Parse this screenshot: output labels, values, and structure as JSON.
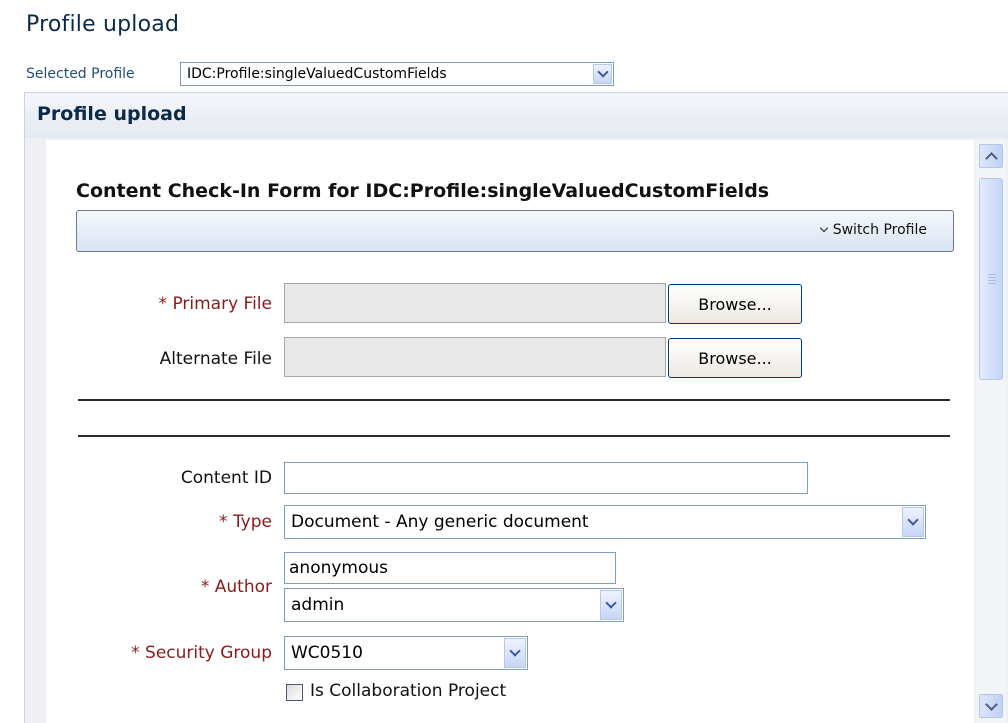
{
  "header": {
    "title": "Profile upload",
    "selected_profile_label": "Selected Profile",
    "selected_profile_value": "IDC:Profile:singleValuedCustomFields"
  },
  "panel": {
    "title": "Profile upload"
  },
  "form": {
    "title": "Content Check-In Form for IDC:Profile:singleValuedCustomFields",
    "switch_profile_label": "Switch Profile",
    "primary_file_label": "* Primary File",
    "primary_file_value": "",
    "alternate_file_label": "Alternate File",
    "alternate_file_value": "",
    "browse_label": "Browse...",
    "content_id_label": "Content ID",
    "content_id_value": "",
    "type_label": "* Type",
    "type_value": "Document - Any generic document",
    "author_label": "* Author",
    "author_value": "anonymous",
    "author_select_value": "admin",
    "security_group_label": "* Security Group",
    "security_group_value": "WC0510",
    "collaboration_label": "Is Collaboration Project",
    "collaboration_checked": false
  },
  "icons": {
    "dropdown": "chevron-down-icon",
    "scroll_up": "scroll-up-arrow-icon",
    "scroll_down": "scroll-down-arrow-icon"
  },
  "colors": {
    "title": "#0b2a4a",
    "required_label": "#8b1a1a",
    "profile_label": "#1f4e79",
    "input_border": "#7f9db9"
  }
}
